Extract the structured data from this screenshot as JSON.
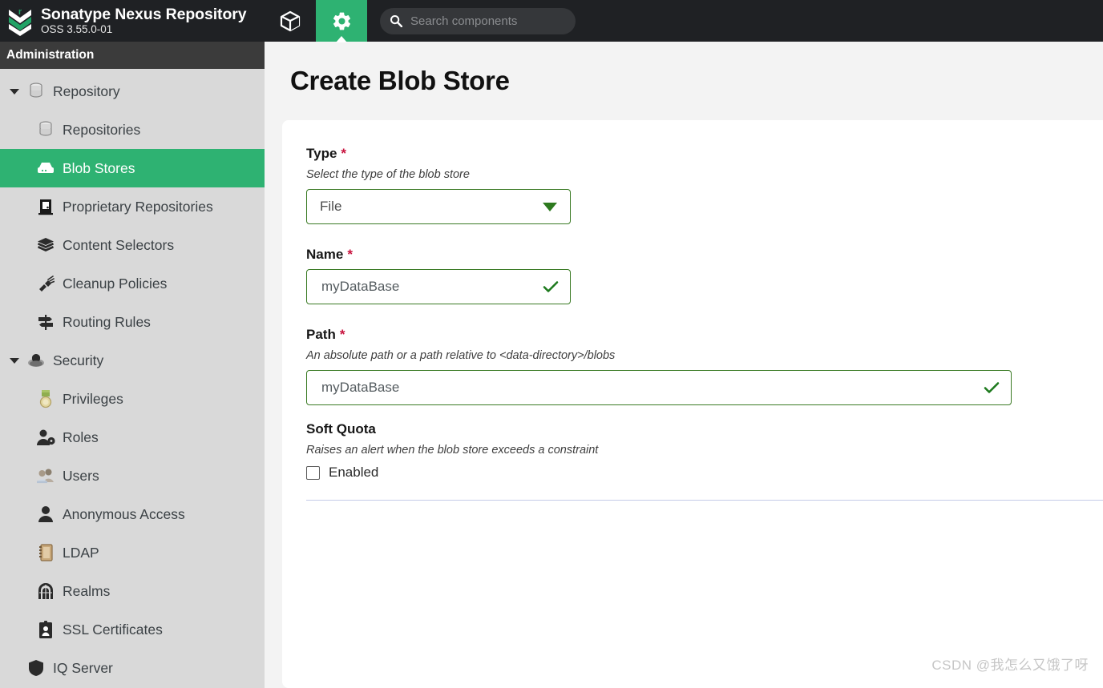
{
  "header": {
    "brand_title": "Sonatype Nexus Repository",
    "brand_version": "OSS 3.55.0-01",
    "logo_icon": "sonatype-chevron-logo",
    "nav": [
      {
        "id": "browse",
        "icon": "cube-icon",
        "label": "Browse",
        "active": false
      },
      {
        "id": "administration",
        "icon": "gear-icon",
        "label": "Administration",
        "active": true
      }
    ],
    "search": {
      "icon": "search-icon",
      "placeholder": "Search components",
      "value": ""
    }
  },
  "sidebar": {
    "title": "Administration",
    "items": [
      {
        "id": "repository",
        "label": "Repository",
        "icon": "database-icon",
        "level": "group",
        "expanded": true,
        "selected": false
      },
      {
        "id": "repositories",
        "label": "Repositories",
        "icon": "database-icon",
        "level": "child",
        "expanded": null,
        "selected": false
      },
      {
        "id": "blob-stores",
        "label": "Blob Stores",
        "icon": "blobstore-icon",
        "level": "child",
        "expanded": null,
        "selected": true
      },
      {
        "id": "proprietary-repositories",
        "label": "Proprietary Repositories",
        "icon": "door-icon",
        "level": "child",
        "expanded": null,
        "selected": false
      },
      {
        "id": "content-selectors",
        "label": "Content Selectors",
        "icon": "layers-icon",
        "level": "child",
        "expanded": null,
        "selected": false
      },
      {
        "id": "cleanup-policies",
        "label": "Cleanup Policies",
        "icon": "broom-icon",
        "level": "child",
        "expanded": null,
        "selected": false
      },
      {
        "id": "routing-rules",
        "label": "Routing Rules",
        "icon": "signpost-icon",
        "level": "child",
        "expanded": null,
        "selected": false
      },
      {
        "id": "security",
        "label": "Security",
        "icon": "shield-user-icon",
        "level": "group",
        "expanded": true,
        "selected": false
      },
      {
        "id": "privileges",
        "label": "Privileges",
        "icon": "medal-icon",
        "level": "child",
        "expanded": null,
        "selected": false
      },
      {
        "id": "roles",
        "label": "Roles",
        "icon": "user-tag-icon",
        "level": "child",
        "expanded": null,
        "selected": false
      },
      {
        "id": "users",
        "label": "Users",
        "icon": "users-icon",
        "level": "child",
        "expanded": null,
        "selected": false
      },
      {
        "id": "anonymous-access",
        "label": "Anonymous Access",
        "icon": "person-icon",
        "level": "child",
        "expanded": null,
        "selected": false
      },
      {
        "id": "ldap",
        "label": "LDAP",
        "icon": "address-book-icon",
        "level": "child",
        "expanded": null,
        "selected": false
      },
      {
        "id": "realms",
        "label": "Realms",
        "icon": "gate-icon",
        "level": "child",
        "expanded": null,
        "selected": false
      },
      {
        "id": "ssl-certificates",
        "label": "SSL Certificates",
        "icon": "id-badge-icon",
        "level": "child",
        "expanded": null,
        "selected": false
      },
      {
        "id": "iq-server",
        "label": "IQ Server",
        "icon": "shield-icon",
        "level": "group-noarrow",
        "expanded": null,
        "selected": false
      }
    ]
  },
  "main": {
    "page_title": "Create Blob Store",
    "fields": {
      "type": {
        "label": "Type",
        "required_mark": "*",
        "description": "Select the type of the blob store",
        "selected_option": "File",
        "options": [
          "File"
        ],
        "caret_icon": "chevron-down-icon"
      },
      "name": {
        "label": "Name",
        "required_mark": "*",
        "value": "myDataBase",
        "valid_icon": "check-icon"
      },
      "path": {
        "label": "Path",
        "required_mark": "*",
        "description": "An absolute path or a path relative to <data-directory>/blobs",
        "value": "myDataBase",
        "valid_icon": "check-icon"
      },
      "soft_quota": {
        "label": "Soft Quota",
        "description": "Raises an alert when the blob store exceeds a constraint",
        "checkbox_label": "Enabled",
        "checked": false
      }
    }
  },
  "watermark": "CSDN @我怎么又饿了呀",
  "colors": {
    "accent_green": "#2eb272",
    "topbar_dark": "#1f2124",
    "sidebar_header_dark": "#3b3b3b",
    "sidebar_bg": "#d9d9d9",
    "main_bg": "#f3f3f3",
    "card_bg": "#ffffff",
    "required_red": "#c8133e",
    "input_border_green": "#3a7a24",
    "divider": "#c5cbe8"
  }
}
